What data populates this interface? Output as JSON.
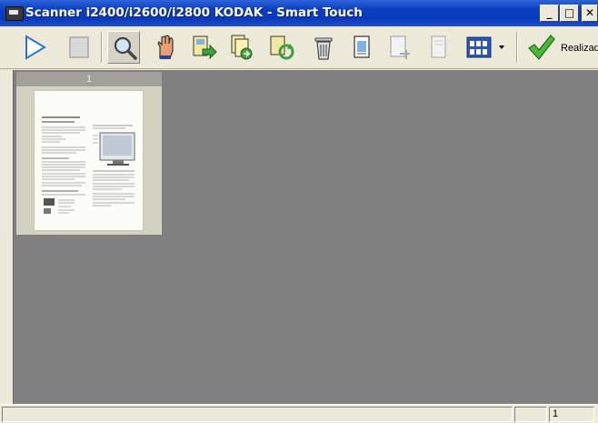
{
  "window": {
    "title": "Scanner i2400/i2600/i2800 KODAK - Smart Touch",
    "minimize_label": "_",
    "maximize_label": "□",
    "close_label": "✕"
  },
  "toolbar": {
    "buttons": [
      {
        "icon": "play-icon",
        "active": false
      },
      {
        "icon": "stop-icon",
        "active": false
      },
      {
        "icon": "magnifier-icon",
        "active": true
      },
      {
        "icon": "hand-icon",
        "active": false
      },
      {
        "icon": "page-arrow-icon",
        "active": false
      },
      {
        "icon": "page-sort-icon",
        "active": false
      },
      {
        "icon": "page-rotate-icon",
        "active": false
      },
      {
        "icon": "trash-icon",
        "active": false
      },
      {
        "icon": "page-edit-icon",
        "active": false
      },
      {
        "icon": "page-crop-disabled-icon",
        "active": false
      },
      {
        "icon": "page-blank-disabled-icon",
        "active": false
      },
      {
        "icon": "thumbnail-view-icon",
        "active": false
      }
    ],
    "done_label": "Realizad"
  },
  "thumbnails": [
    {
      "number": "1"
    }
  ],
  "statusbar": {
    "page_count": "1"
  },
  "colors": {
    "titlebar": "#0a3fc4",
    "workspace": "#808080",
    "chrome": "#ece9d8"
  }
}
